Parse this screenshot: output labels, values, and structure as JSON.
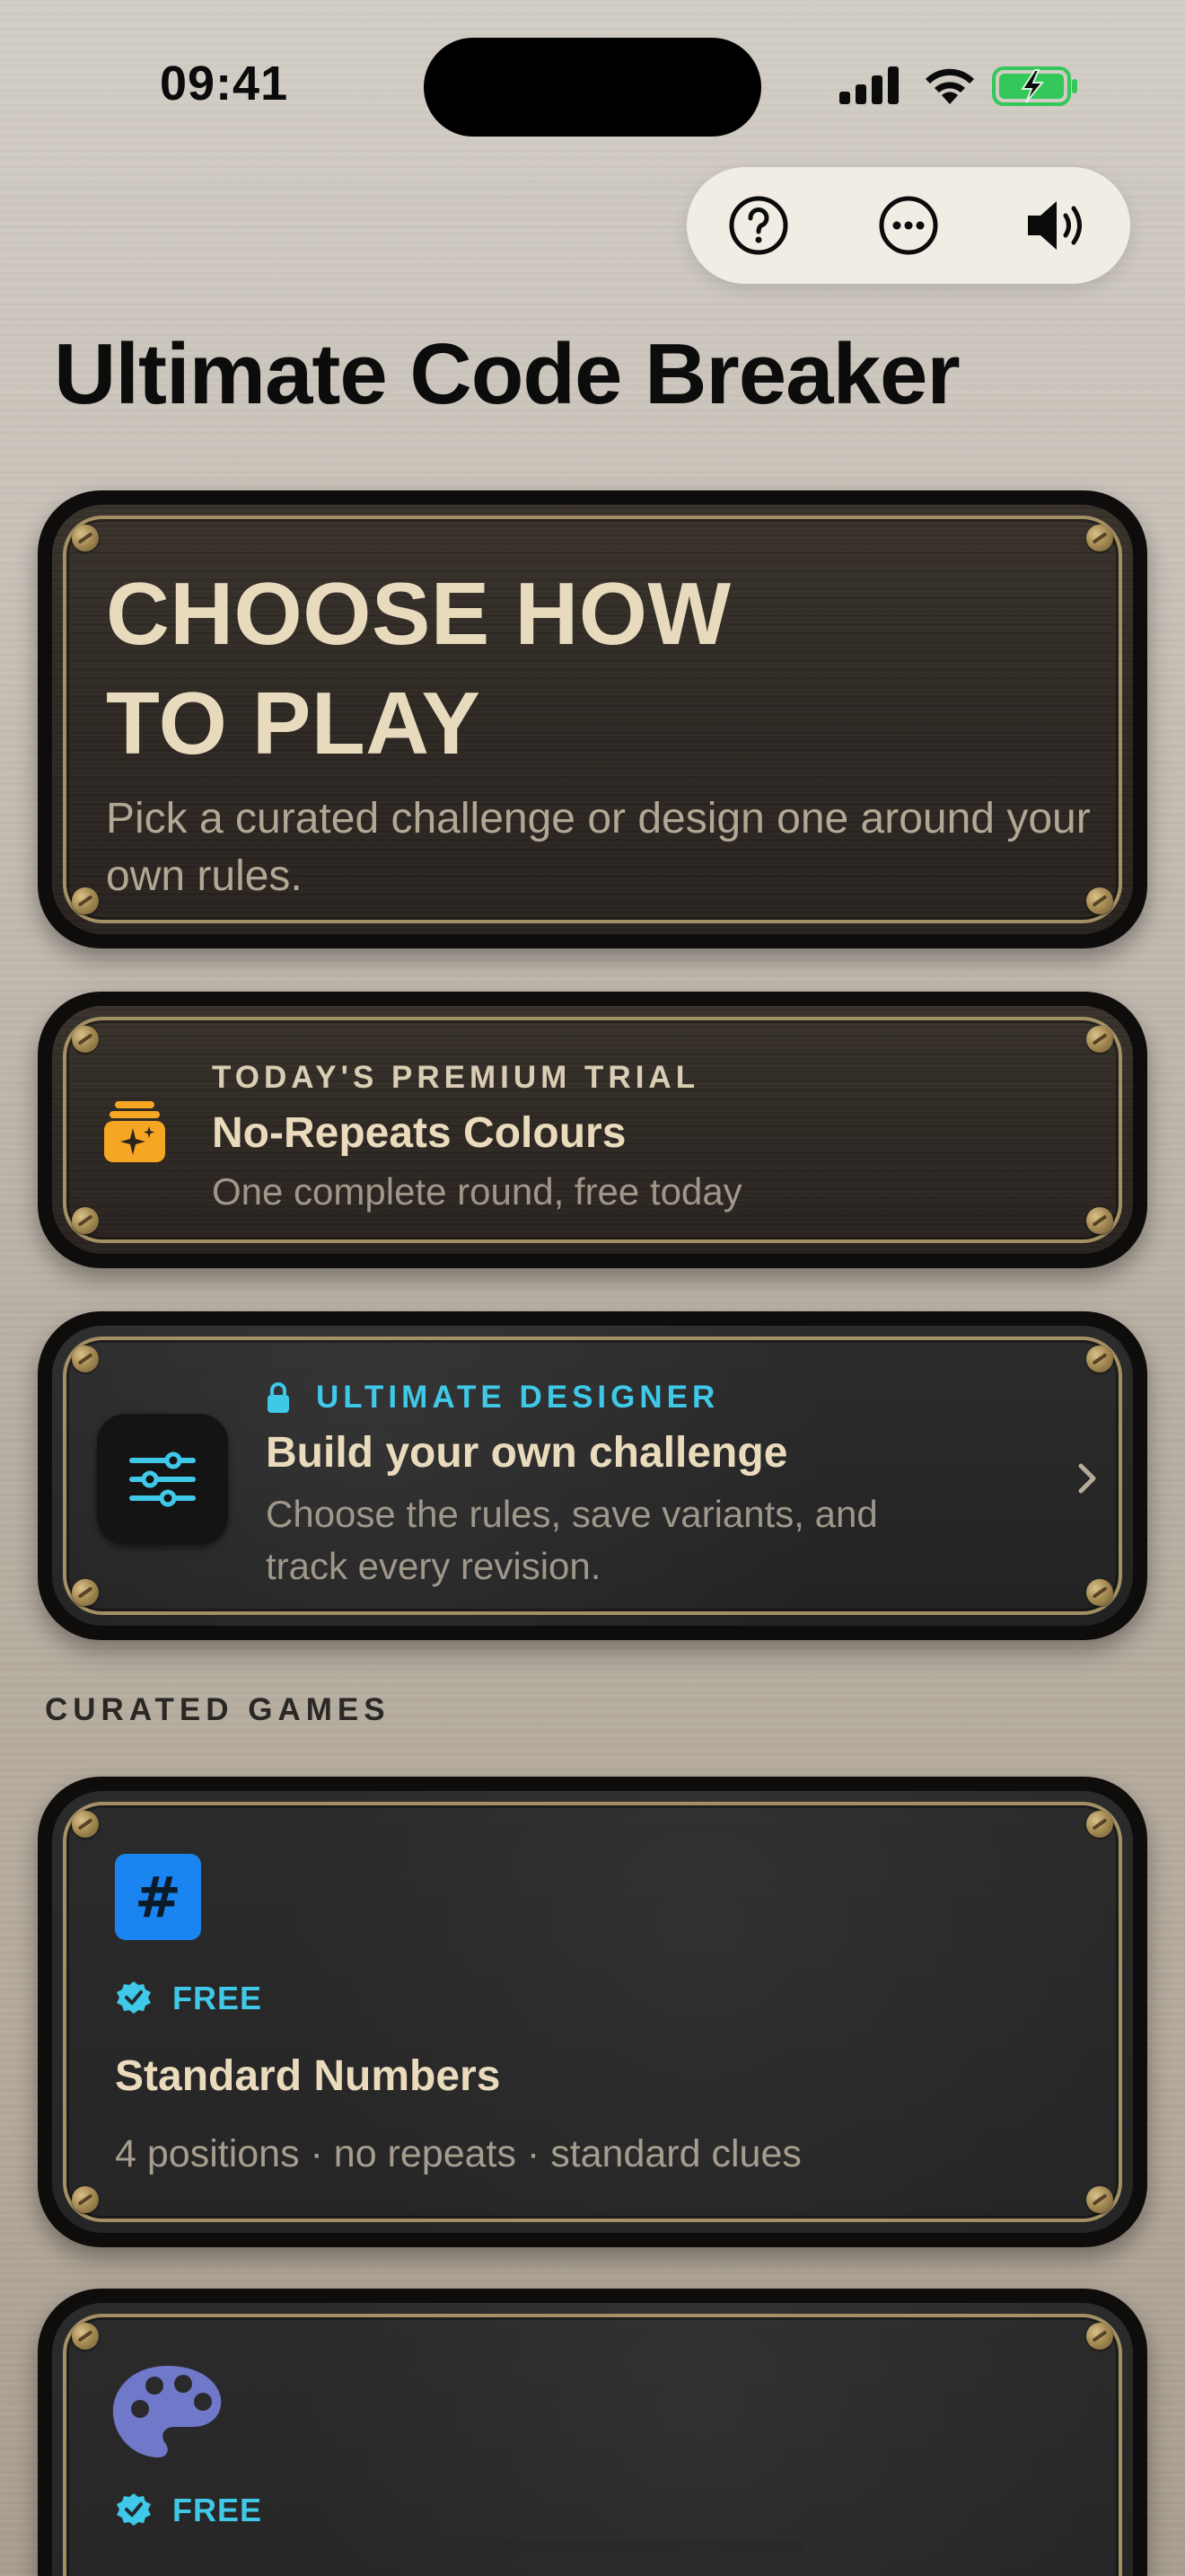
{
  "status_bar": {
    "time": "09:41"
  },
  "top_pill": {
    "help_icon": "question-circle-icon",
    "more_icon": "ellipsis-circle-icon",
    "sound_icon": "speaker-wave-icon"
  },
  "title": "Ultimate Code Breaker",
  "hero": {
    "title_line1": "CHOOSE HOW",
    "title_line2": "TO PLAY",
    "subtitle": "Pick a curated challenge or design one around your own rules."
  },
  "trial": {
    "eyebrow": "TODAY'S PREMIUM TRIAL",
    "heading": "No-Repeats Colours",
    "description": "One complete round, free today",
    "icon": "sparkle-stack-icon",
    "icon_color": "#f5a623"
  },
  "designer": {
    "eyebrow": "ULTIMATE DESIGNER",
    "heading": "Build your own challenge",
    "description_line1": "Choose the rules, save variants, and",
    "description_line2": "track every revision.",
    "accent": "#3fc8e8",
    "icon": "sliders-icon"
  },
  "section": {
    "curated_label": "CURATED GAMES"
  },
  "games": [
    {
      "icon": "hash-icon",
      "icon_color": "#1a84f0",
      "badge": "FREE",
      "title": "Standard Numbers",
      "description": "4 positions · no repeats · standard clues"
    },
    {
      "icon": "palette-icon",
      "icon_color": "#6f78c9",
      "badge": "FREE",
      "title": "",
      "description": ""
    }
  ]
}
